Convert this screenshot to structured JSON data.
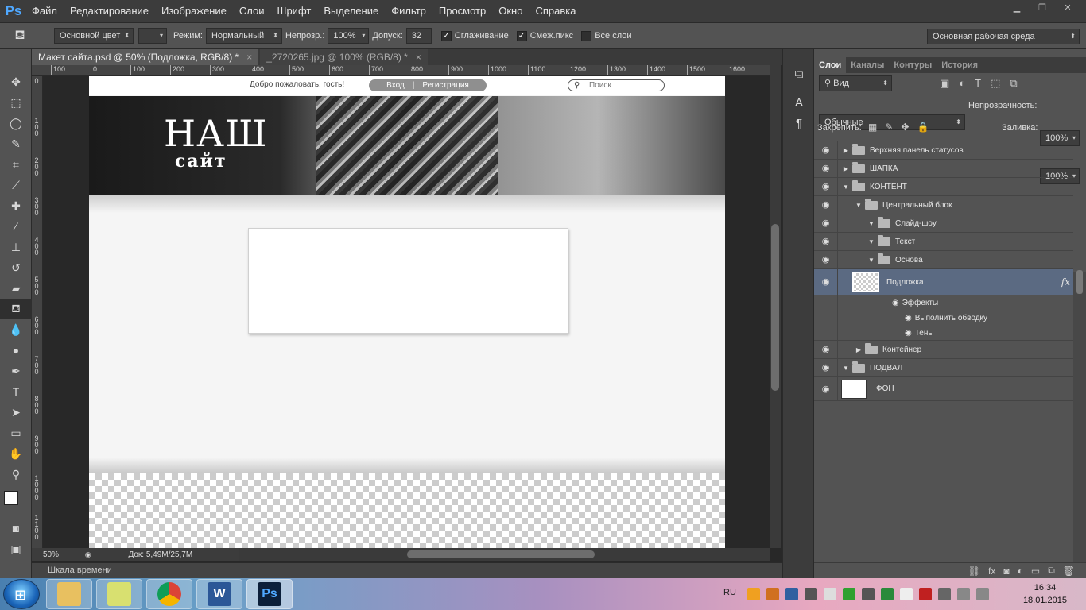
{
  "app": {
    "logo": "Ps"
  },
  "menu": [
    "Файл",
    "Редактирование",
    "Изображение",
    "Слои",
    "Шрифт",
    "Выделение",
    "Фильтр",
    "Просмотр",
    "Окно",
    "Справка"
  ],
  "window_controls": {
    "minimize": "▁",
    "restore": "❐",
    "close": "✕"
  },
  "options": {
    "fill_source": "Основной цвет",
    "mode_label": "Режим:",
    "mode_value": "Нормальный",
    "opacity_label": "Непрозр.:",
    "opacity_value": "100%",
    "tolerance_label": "Допуск:",
    "tolerance_value": "32",
    "antialias_label": "Сглаживание",
    "contiguous_label": "Смеж.пикс",
    "all_layers_label": "Все слои",
    "workspace": "Основная рабочая среда"
  },
  "tabs": [
    {
      "label": "Макет сайта.psd @ 50% (Подложка, RGB/8) *",
      "close": "×"
    },
    {
      "label": "_2720265.jpg @ 100% (RGB/8) *",
      "close": "×"
    }
  ],
  "ruler_h": [
    "100",
    "0",
    "100",
    "200",
    "300",
    "400",
    "500",
    "600",
    "700",
    "800",
    "900",
    "1000",
    "1100",
    "1200",
    "1300",
    "1400",
    "1500",
    "1600"
  ],
  "ruler_v": [
    "0",
    "1\n0\n0",
    "2\n0\n0",
    "3\n0\n0",
    "4\n0\n0",
    "5\n0\n0",
    "6\n0\n0",
    "7\n0\n0",
    "8\n0\n0",
    "9\n0\n0",
    "1\n0\n0\n0",
    "1\n1\n0\n0"
  ],
  "document": {
    "welcome": "Добро пожаловать, гость!",
    "login": "Вход",
    "separator": "|",
    "register": "Регистрация",
    "search_placeholder": "Поиск",
    "logo_line1": "НАШ",
    "logo_line2": "сайт"
  },
  "status": {
    "zoom": "50%",
    "doc": "Док: 5,49M/25,7M"
  },
  "timeline_label": "Шкала времени",
  "layers_panel": {
    "tabs": [
      "Слои",
      "Каналы",
      "Контуры",
      "История"
    ],
    "filter": "Вид",
    "blend_mode": "Обычные",
    "opacity_label": "Непрозрачность:",
    "opacity_value": "100%",
    "lock_label": "Закрепить:",
    "fill_label": "Заливка:",
    "fill_value": "100%",
    "layers": [
      {
        "name": "Верхняя панель статусов"
      },
      {
        "name": "ШАПКА"
      },
      {
        "name": "КОНТЕНТ"
      },
      {
        "name": "Центральный блок"
      },
      {
        "name": "Слайд-шоу"
      },
      {
        "name": "Текст"
      },
      {
        "name": "Основа"
      },
      {
        "name": "Подложка"
      },
      {
        "name": "Эффекты"
      },
      {
        "name": "Выполнить обводку"
      },
      {
        "name": "Тень"
      },
      {
        "name": "Контейнер"
      },
      {
        "name": "ПОДВАЛ"
      },
      {
        "name": "ФОН"
      }
    ],
    "fx": "fx"
  },
  "taskbar": {
    "lang": "RU",
    "time": "16:34",
    "date": "18.01.2015",
    "apps": [
      "explorer",
      "chrome",
      "word",
      "photoshop"
    ]
  }
}
